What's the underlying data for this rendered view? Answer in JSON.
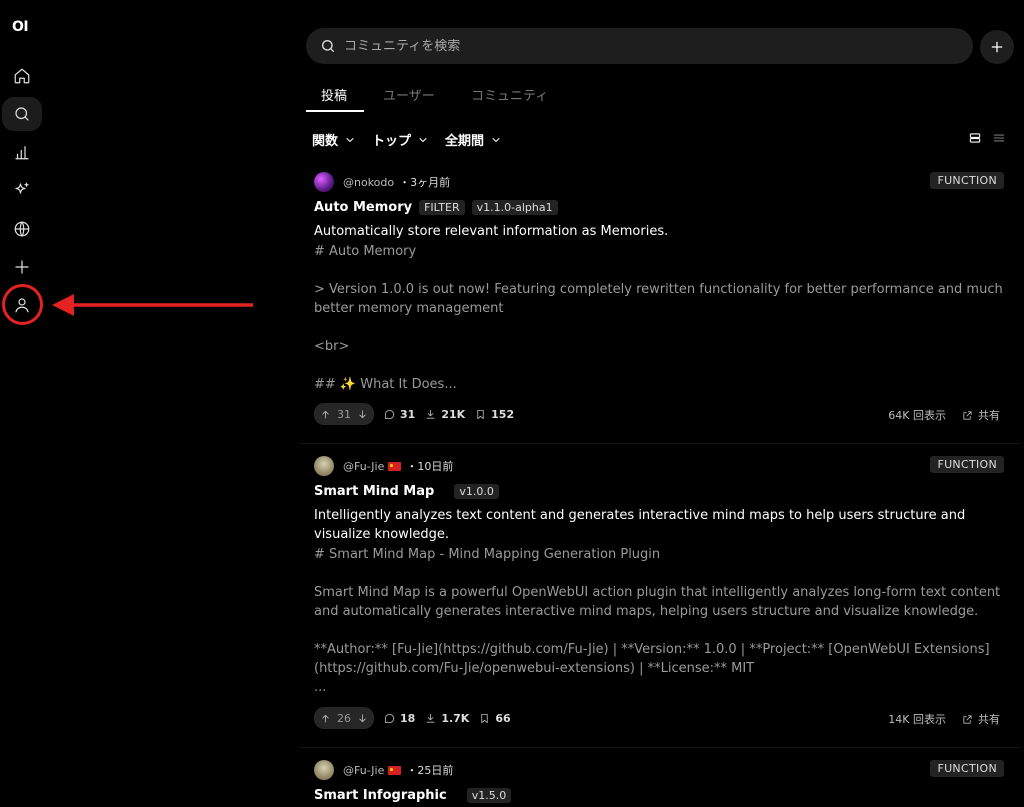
{
  "app": {
    "logo": "OI"
  },
  "sidebar": {
    "items": [
      {
        "name": "home",
        "icon": "home-icon"
      },
      {
        "name": "search",
        "icon": "search-icon",
        "active": true
      },
      {
        "name": "leaderboard",
        "icon": "bar-chart-icon"
      },
      {
        "name": "discover",
        "icon": "sparkle-icon"
      },
      {
        "name": "community",
        "icon": "globe-icon"
      },
      {
        "name": "create",
        "icon": "plus-icon"
      },
      {
        "name": "profile",
        "icon": "user-icon"
      }
    ]
  },
  "search": {
    "placeholder": "コミュニティを検索"
  },
  "tabs": [
    {
      "label": "投稿",
      "active": true
    },
    {
      "label": "ユーザー",
      "active": false
    },
    {
      "label": "コミュニティ",
      "active": false
    }
  ],
  "filters": {
    "type": "関数",
    "sort": "トップ",
    "period": "全期間"
  },
  "colors": {
    "annotation": "#e52222",
    "background": "#000000"
  },
  "posts": [
    {
      "author": "@nokodo",
      "time": "・3ヶ月前",
      "type": "FUNCTION",
      "title": "Auto Memory",
      "tags": [
        "FILTER",
        "v1.1.0-alpha1"
      ],
      "description": "Automatically store relevant information as Memories.",
      "body": "# Auto Memory\n\n> Version 1.0.0 is out now! Featuring completely rewritten functionality for better performance and much better memory management\n\n<br>\n\n## ✨ What It Does...",
      "votes": "31",
      "comments": "31",
      "downloads": "21K",
      "saves": "152",
      "views": "64K 回表示",
      "share": "共有"
    },
    {
      "author": "@Fu-Jie",
      "time": "・10日前",
      "type": "FUNCTION",
      "title": "Smart Mind Map",
      "tags": [
        "v1.0.0"
      ],
      "description": "Intelligently analyzes text content and generates interactive mind maps to help users structure and visualize knowledge.",
      "body": "# Smart Mind Map - Mind Mapping Generation Plugin\n\nSmart Mind Map is a powerful OpenWebUI action plugin that intelligently analyzes long-form text content and automatically generates interactive mind maps, helping users structure and visualize knowledge.\n\n**Author:** [Fu-Jie](https://github.com/Fu-Jie) | **Version:** 1.0.0 | **Project:** [OpenWebUI Extensions](https://github.com/Fu-Jie/openwebui-extensions) | **License:** MIT\n...",
      "votes": "26",
      "comments": "18",
      "downloads": "1.7K",
      "saves": "66",
      "views": "14K 回表示",
      "share": "共有"
    },
    {
      "author": "@Fu-Jie",
      "time": "・25日前",
      "type": "FUNCTION",
      "title": "Smart Infographic",
      "tags": [
        "v1.5.0"
      ]
    }
  ]
}
